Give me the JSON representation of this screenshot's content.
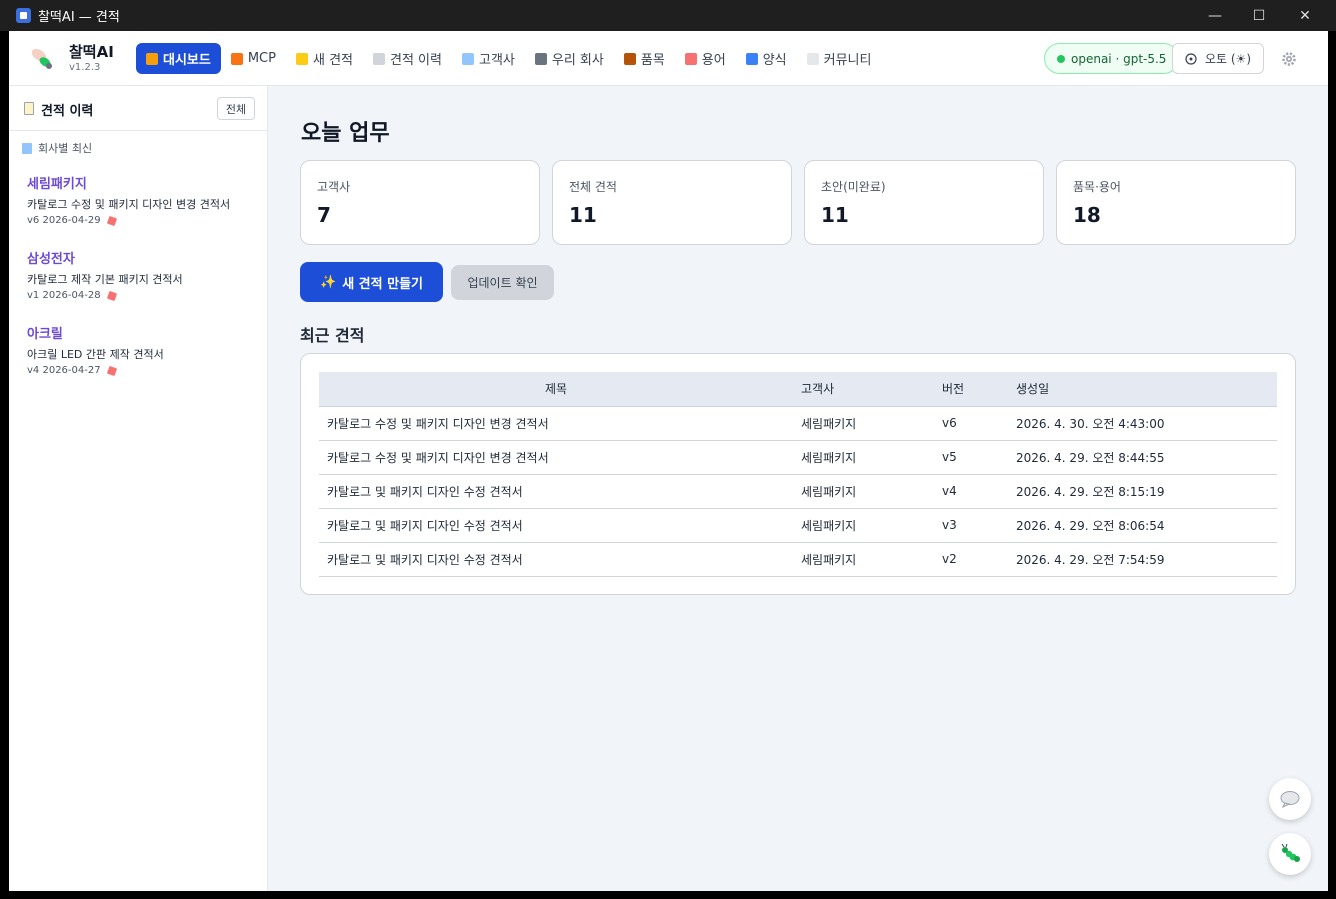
{
  "window": {
    "title": "찰떡AI — 견적",
    "minimize": "—",
    "maximize": "☐",
    "close": "✕"
  },
  "header": {
    "brand_name": "찰떡AI",
    "version": "v1.2.3",
    "nav": [
      {
        "label": "대시보드",
        "icon": "house-icon",
        "color": "#f59e0b"
      },
      {
        "label": "MCP",
        "icon": "compass-icon",
        "color": "#f97316"
      },
      {
        "label": "새 견적",
        "icon": "sparkle-icon",
        "color": "#facc15"
      },
      {
        "label": "견적 이력",
        "icon": "clipboard-icon",
        "color": "#d1d5db"
      },
      {
        "label": "고객사",
        "icon": "building-icon",
        "color": "#93c5fd"
      },
      {
        "label": "우리 회사",
        "icon": "factory-icon",
        "color": "#6b7280"
      },
      {
        "label": "품목",
        "icon": "package-icon",
        "color": "#b45309"
      },
      {
        "label": "용어",
        "icon": "pencil-icon",
        "color": "#f87171"
      },
      {
        "label": "양식",
        "icon": "book-icon",
        "color": "#3b82f6"
      },
      {
        "label": "커뮤니티",
        "icon": "chat-bubble-icon",
        "color": "#e5e7eb"
      }
    ],
    "model_badge": "openai · gpt-5.5",
    "theme_button": "오토 (☀)"
  },
  "sidebar": {
    "title": "견적 이력",
    "all_button": "전체",
    "group_label": "회사별 최신",
    "entries": [
      {
        "company": "세림패키지",
        "title": "카탈로그 수정 및 패키지 디자인 변경 견적서",
        "version": "v6",
        "date": "2026-04-29"
      },
      {
        "company": "삼성전자",
        "title": "카탈로그 제작 기본 패키지 견적서",
        "version": "v1",
        "date": "2026-04-28"
      },
      {
        "company": "아크릴",
        "title": "아크릴 LED 간판 제작 견적서",
        "version": "v4",
        "date": "2026-04-27"
      }
    ]
  },
  "main": {
    "page_title": "오늘 업무",
    "stats": [
      {
        "label": "고객사",
        "value": "7"
      },
      {
        "label": "전체 견적",
        "value": "11"
      },
      {
        "label": "초안(미완료)",
        "value": "11"
      },
      {
        "label": "품목·용어",
        "value": "18"
      }
    ],
    "new_quote_button": "새 견적 만들기",
    "update_button": "업데이트 확인",
    "recent_title": "최근 견적",
    "table": {
      "headers": [
        "제목",
        "고객사",
        "버전",
        "생성일"
      ],
      "rows": [
        [
          "카탈로그 수정 및 패키지 디자인 변경 견적서",
          "세림패키지",
          "v6",
          "2026. 4. 30. 오전 4:43:00"
        ],
        [
          "카탈로그 수정 및 패키지 디자인 변경 견적서",
          "세림패키지",
          "v5",
          "2026. 4. 29. 오전 8:44:55"
        ],
        [
          "카탈로그 및 패키지 디자인 수정 견적서",
          "세림패키지",
          "v4",
          "2026. 4. 29. 오전 8:15:19"
        ],
        [
          "카탈로그 및 패키지 디자인 수정 견적서",
          "세림패키지",
          "v3",
          "2026. 4. 29. 오전 8:06:54"
        ],
        [
          "카탈로그 및 패키지 디자인 수정 견적서",
          "세림패키지",
          "v2",
          "2026. 4. 29. 오전 7:54:59"
        ]
      ]
    }
  },
  "fab": {
    "chat_icon": "chat-bubble-icon",
    "mascot_icon": "caterpillar-icon"
  }
}
